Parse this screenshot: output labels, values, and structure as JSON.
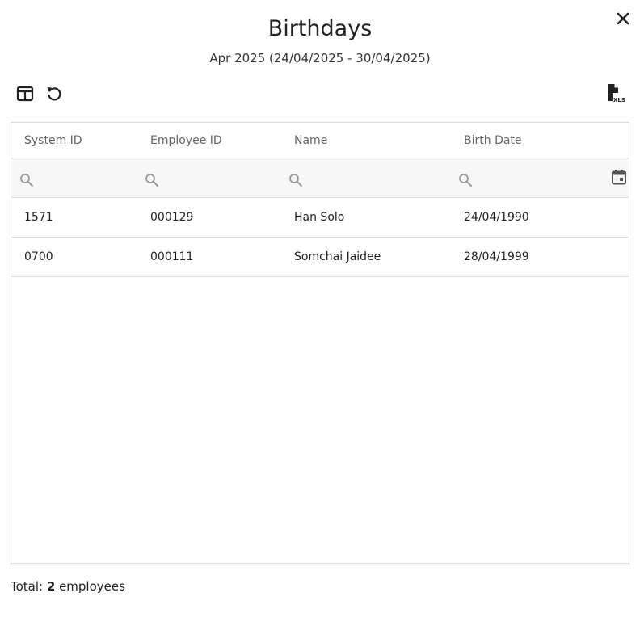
{
  "dialog": {
    "title": "Birthdays",
    "subtitle": "Apr 2025 (24/04/2025 - 30/04/2025)"
  },
  "toolbar": {
    "columns_icon": "view-columns-icon",
    "reset_icon": "reset-icon",
    "export_icon": "xls-export-icon",
    "export_badge": "XLS"
  },
  "table": {
    "headers": [
      "System ID",
      "Employee ID",
      "Name",
      "Birth Date"
    ],
    "rows": [
      [
        "1571",
        "000129",
        "Han Solo",
        "24/04/1990"
      ],
      [
        "0700",
        "000111",
        "Somchai Jaidee",
        "28/04/1999"
      ]
    ]
  },
  "footer": {
    "prefix": "Total: ",
    "count": "2",
    "suffix": " employees"
  }
}
